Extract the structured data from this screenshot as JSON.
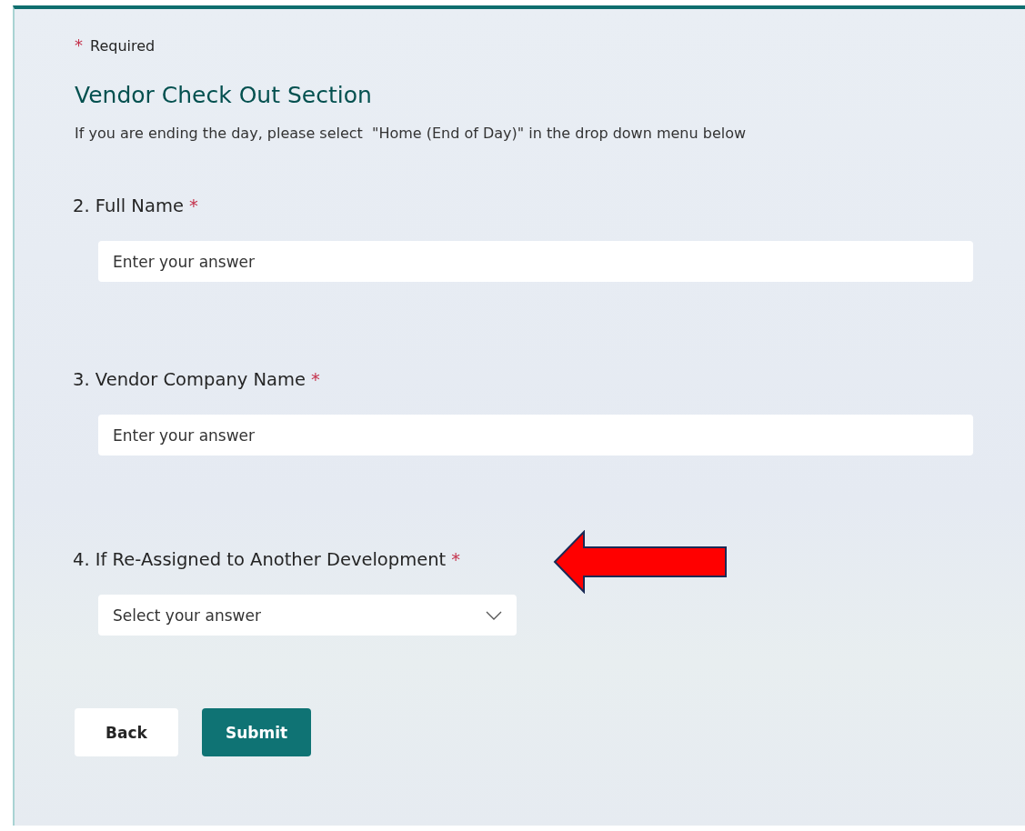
{
  "required_note": {
    "mark": "*",
    "label": "Required"
  },
  "section": {
    "title": "Vendor Check Out Section",
    "description": "If you are ending the day, please select  \"Home (End of Day)\" in the drop down menu below"
  },
  "questions": [
    {
      "kind": "text",
      "number": "2.",
      "label": "Full Name",
      "required": true,
      "placeholder": "Enter your answer"
    },
    {
      "kind": "text",
      "number": "3.",
      "label": "Vendor Company Name",
      "required": true,
      "placeholder": "Enter your answer"
    },
    {
      "kind": "choice",
      "number": "4.",
      "label": "If Re-Assigned to Another Development",
      "required": true,
      "placeholder": "Select your answer"
    }
  ],
  "buttons": [
    {
      "label": "Back",
      "kind": "secondary"
    },
    {
      "label": "Submit",
      "kind": "primary"
    }
  ]
}
